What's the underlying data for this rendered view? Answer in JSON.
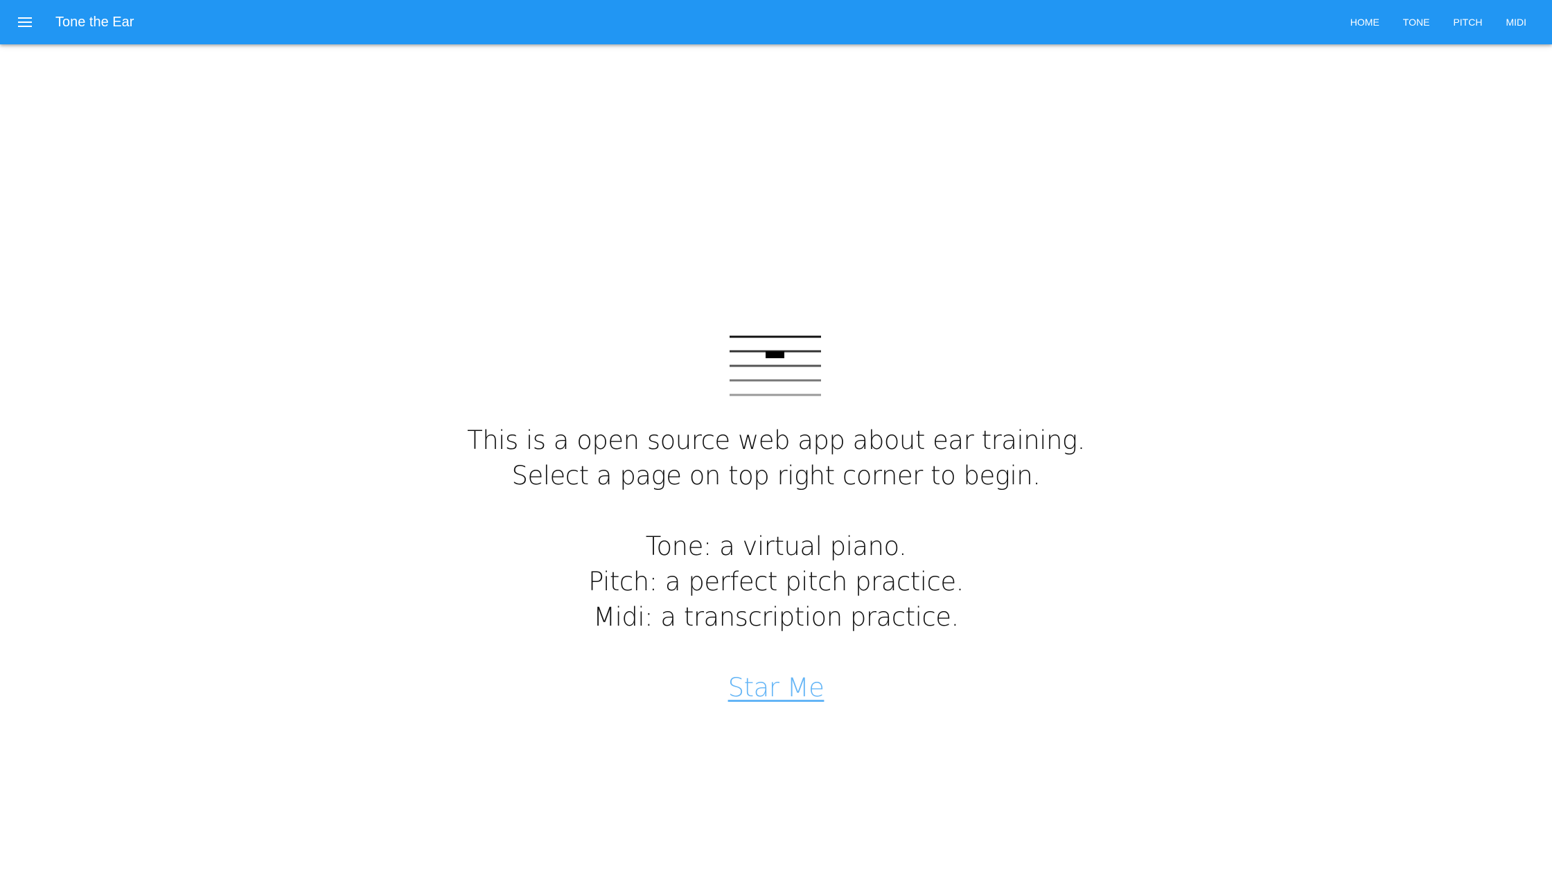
{
  "header": {
    "title": "Tone the Ear",
    "menu_icon": "menu-icon",
    "background_color": "#2196f3",
    "nav": [
      {
        "label": "HOME"
      },
      {
        "label": "TONE"
      },
      {
        "label": "PITCH"
      },
      {
        "label": "MIDI"
      }
    ]
  },
  "logo": {
    "icon": "music-staff-icon"
  },
  "intro": {
    "line1": "This is a open source web app about ear training.",
    "line2": "Select a page on top right corner to begin.",
    "tone": "Tone: a virtual piano.",
    "pitch": "Pitch: a perfect pitch practice.",
    "midi": "Midi: a transcription practice.",
    "link_label": "Star Me",
    "link_color": "#64b5f6"
  }
}
